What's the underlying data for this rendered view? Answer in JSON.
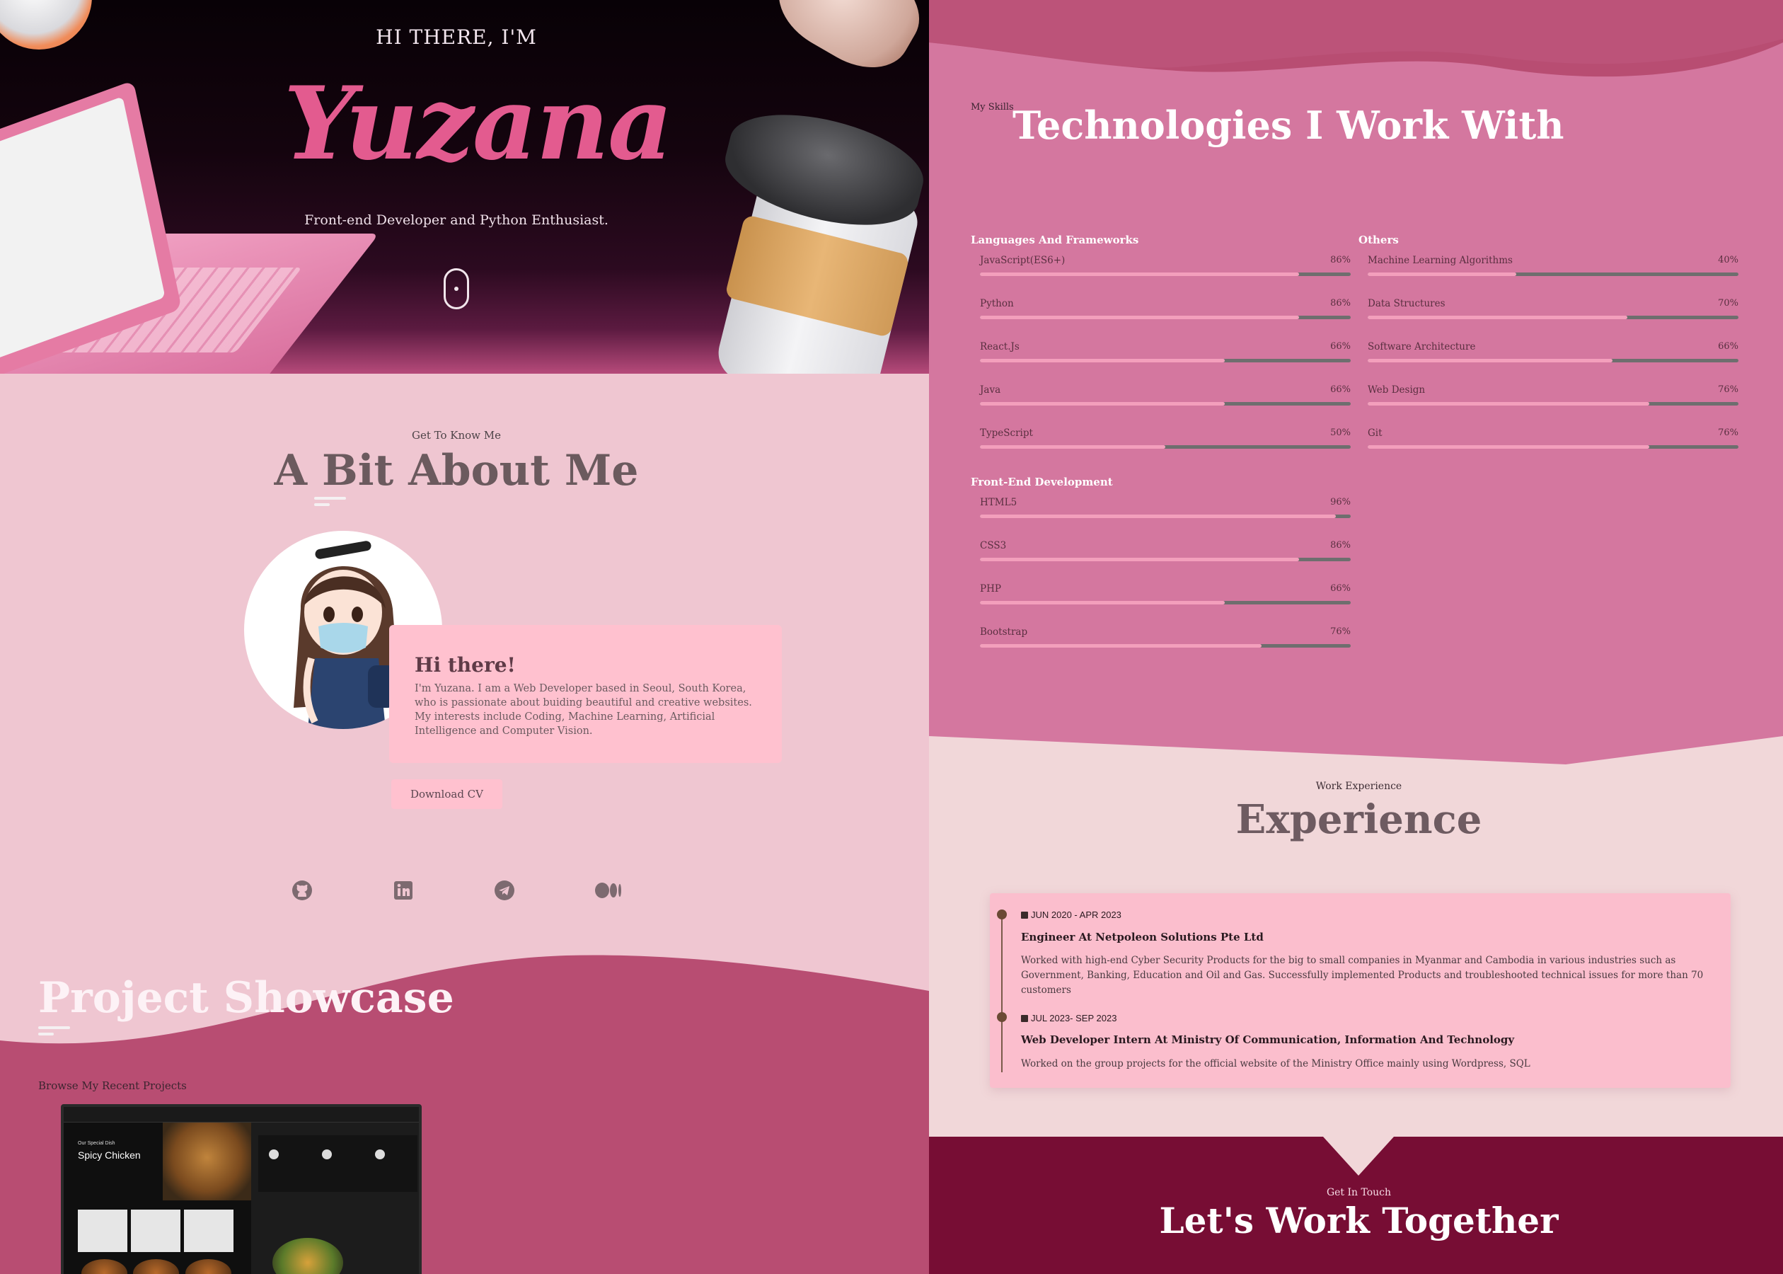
{
  "hero": {
    "greeting": "HI THERE, I'M",
    "name": "Yuzana",
    "subtitle": "Front-end Developer and Python Enthusiast."
  },
  "about": {
    "eyebrow": "Get To Know Me",
    "title": "A Bit About Me",
    "card_title": "Hi there!",
    "card_text": "I'm Yuzana. I am a Web Developer based in Seoul, South Korea, who is passionate about buiding beautiful and creative websites. My interests include Coding, Machine Learning, Artificial Intelligence and Computer Vision.",
    "cv_button": "Download CV",
    "socials": [
      "github-icon",
      "linkedin-icon",
      "telegram-icon",
      "medium-icon"
    ]
  },
  "projects": {
    "title": "Project Showcase",
    "browse": "Browse My Recent Projects",
    "preview": {
      "label": "Our Special Dish",
      "heading": "Spicy Chicken"
    }
  },
  "skills": {
    "eyebrow": "My Skills",
    "title": "Technologies I Work With",
    "groups": [
      {
        "title": "Languages And Frameworks",
        "items": [
          {
            "name": "JavaScript(ES6+)",
            "pct": "86%",
            "value": 0.86
          },
          {
            "name": "Python",
            "pct": "86%",
            "value": 0.86
          },
          {
            "name": "React.Js",
            "pct": "66%",
            "value": 0.66
          },
          {
            "name": "Java",
            "pct": "66%",
            "value": 0.66
          },
          {
            "name": "TypeScript",
            "pct": "50%",
            "value": 0.5
          }
        ]
      },
      {
        "title": "Front-End Development",
        "items": [
          {
            "name": "HTML5",
            "pct": "96%",
            "value": 0.96
          },
          {
            "name": "CSS3",
            "pct": "86%",
            "value": 0.86
          },
          {
            "name": "PHP",
            "pct": "66%",
            "value": 0.66
          },
          {
            "name": "Bootstrap",
            "pct": "76%",
            "value": 0.76
          }
        ]
      },
      {
        "title": "Others",
        "items": [
          {
            "name": "Machine Learning Algorithms",
            "pct": "40%",
            "value": 0.4
          },
          {
            "name": "Data Structures",
            "pct": "70%",
            "value": 0.7
          },
          {
            "name": "Software Architecture",
            "pct": "66%",
            "value": 0.66
          },
          {
            "name": "Web Design",
            "pct": "76%",
            "value": 0.76
          },
          {
            "name": "Git",
            "pct": "76%",
            "value": 0.76
          }
        ]
      }
    ]
  },
  "experience": {
    "eyebrow": "Work Experience",
    "title": "Experience",
    "items": [
      {
        "date": "JUN 2020 - APR 2023",
        "role": "Engineer At Netpoleon Solutions Pte Ltd",
        "desc": "Worked with high-end Cyber Security Products for the big to small companies in Myanmar and Cambodia in various industries such as Government, Banking, Education and Oil and Gas. Successfully implemented Products and troubleshooted technical issues for more than 70 customers"
      },
      {
        "date": "JUL 2023- SEP 2023",
        "role": "Web Developer Intern At Ministry Of Communication, Information And Technology",
        "desc": "Worked on the group projects for the official website of the Ministry Office mainly using Wordpress, SQL"
      }
    ]
  },
  "contact": {
    "eyebrow": "Get In Touch",
    "title": "Let's Work Together"
  },
  "colors": {
    "accent_pink": "#e35b8f",
    "skills_bg": "#d4779f",
    "project_bg": "#b84d72",
    "contact_bg": "#770d34"
  }
}
